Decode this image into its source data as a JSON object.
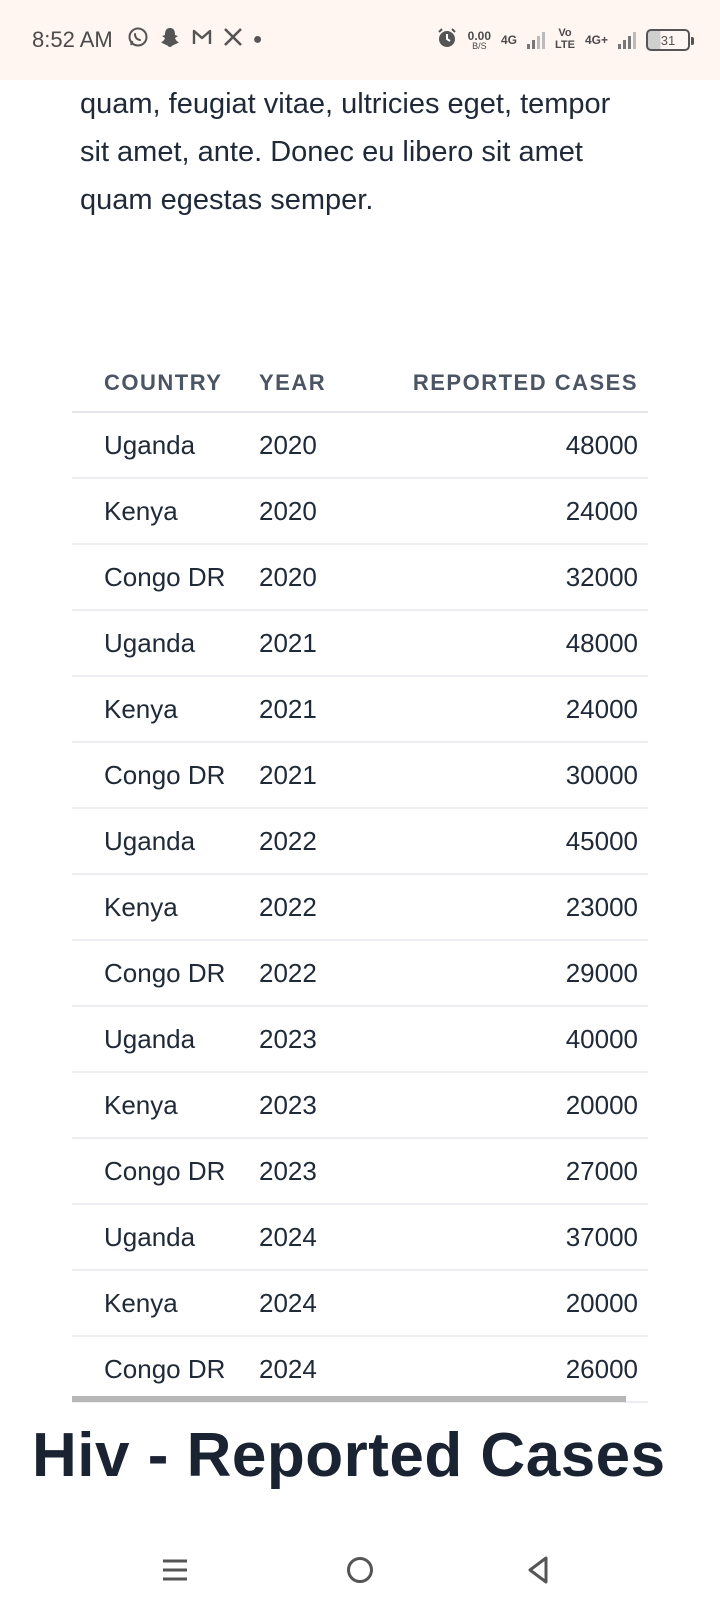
{
  "status_bar": {
    "time": "8:52 AM",
    "net_speed_value": "0.00",
    "net_speed_unit": "B/S",
    "sim1_label": "4G",
    "volte_top": "Vo",
    "volte_bottom": "LTE",
    "sim2_label": "4G+",
    "battery_level": "31",
    "icons": [
      "whatsapp-icon",
      "snapchat-icon",
      "gmail-icon",
      "x-icon",
      "dot-icon",
      "alarm-icon"
    ]
  },
  "content": {
    "paragraph": "quam, feugiat vitae, ultricies eget, tempor sit amet, ante. Donec eu libero sit amet quam egestas semper.",
    "table": {
      "headers": [
        "COUNTRY",
        "YEAR",
        "REPORTED CASES"
      ],
      "rows": [
        [
          "Uganda",
          "2020",
          "48000"
        ],
        [
          "Kenya",
          "2020",
          "24000"
        ],
        [
          "Congo DR",
          "2020",
          "32000"
        ],
        [
          "Uganda",
          "2021",
          "48000"
        ],
        [
          "Kenya",
          "2021",
          "24000"
        ],
        [
          "Congo DR",
          "2021",
          "30000"
        ],
        [
          "Uganda",
          "2022",
          "45000"
        ],
        [
          "Kenya",
          "2022",
          "23000"
        ],
        [
          "Congo DR",
          "2022",
          "29000"
        ],
        [
          "Uganda",
          "2023",
          "40000"
        ],
        [
          "Kenya",
          "2023",
          "20000"
        ],
        [
          "Congo DR",
          "2023",
          "27000"
        ],
        [
          "Uganda",
          "2024",
          "37000"
        ],
        [
          "Kenya",
          "2024",
          "20000"
        ],
        [
          "Congo DR",
          "2024",
          "26000"
        ]
      ]
    },
    "heading": "Hiv - Reported Cases"
  },
  "nav_bar": {
    "buttons": [
      "menu-icon",
      "home-icon",
      "back-icon"
    ]
  }
}
